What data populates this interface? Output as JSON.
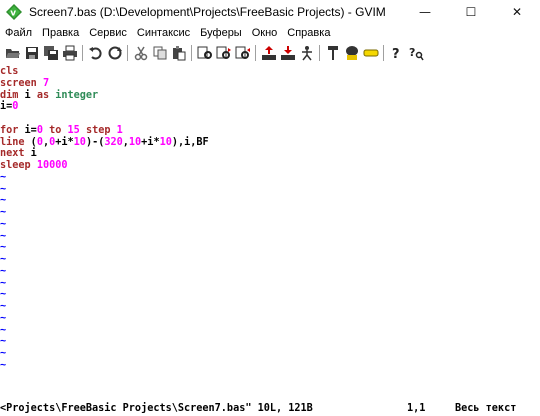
{
  "window": {
    "title": "Screen7.bas (D:\\Development\\Projects\\FreeBasic Projects) - GVIM",
    "minimize": "—",
    "maximize": "☐",
    "close": "✕"
  },
  "menu": [
    "Файл",
    "Правка",
    "Сервис",
    "Синтаксис",
    "Буферы",
    "Окно",
    "Справка"
  ],
  "toolbar_icons": [
    "open-icon",
    "save-icon",
    "save-all-icon",
    "print-icon",
    "undo-icon",
    "redo-icon",
    "cut-icon",
    "copy-icon",
    "paste-icon",
    "find-replace-icon",
    "find-next-icon",
    "find-prev-icon",
    "load-session-icon",
    "save-session-icon",
    "run-script-icon",
    "make-icon",
    "shell-icon",
    "tag-jump-icon",
    "help-icon",
    "find-help-icon"
  ],
  "editor": {
    "lines": [
      [
        {
          "t": "cls",
          "c": "kw"
        }
      ],
      [
        {
          "t": "screen ",
          "c": "kw"
        },
        {
          "t": "7",
          "c": "num"
        }
      ],
      [
        {
          "t": "dim",
          "c": "kw"
        },
        {
          "t": " i ",
          "c": ""
        },
        {
          "t": "as",
          "c": "kw"
        },
        {
          "t": " ",
          "c": ""
        },
        {
          "t": "integer",
          "c": "type"
        }
      ],
      [
        {
          "t": "i=",
          "c": ""
        },
        {
          "t": "0",
          "c": "num"
        }
      ],
      [],
      [
        {
          "t": "for",
          "c": "kw"
        },
        {
          "t": " i=",
          "c": ""
        },
        {
          "t": "0",
          "c": "num"
        },
        {
          "t": " ",
          "c": ""
        },
        {
          "t": "to",
          "c": "kw"
        },
        {
          "t": " ",
          "c": ""
        },
        {
          "t": "15",
          "c": "num"
        },
        {
          "t": " ",
          "c": ""
        },
        {
          "t": "step",
          "c": "kw"
        },
        {
          "t": " ",
          "c": ""
        },
        {
          "t": "1",
          "c": "num"
        }
      ],
      [
        {
          "t": "line",
          "c": "kw"
        },
        {
          "t": " (",
          "c": ""
        },
        {
          "t": "0",
          "c": "num"
        },
        {
          "t": ",",
          "c": ""
        },
        {
          "t": "0",
          "c": "num"
        },
        {
          "t": "+i*",
          "c": ""
        },
        {
          "t": "10",
          "c": "num"
        },
        {
          "t": ")-(",
          "c": ""
        },
        {
          "t": "320",
          "c": "num"
        },
        {
          "t": ",",
          "c": ""
        },
        {
          "t": "10",
          "c": "num"
        },
        {
          "t": "+i*",
          "c": ""
        },
        {
          "t": "10",
          "c": "num"
        },
        {
          "t": "),i,BF",
          "c": ""
        }
      ],
      [
        {
          "t": "next",
          "c": "kw"
        },
        {
          "t": " i",
          "c": ""
        }
      ],
      [
        {
          "t": "sleep",
          "c": "kw"
        },
        {
          "t": " ",
          "c": ""
        },
        {
          "t": "10000",
          "c": "num"
        }
      ]
    ],
    "empty_marker": "~",
    "empty_marker_count": 17
  },
  "status": {
    "message": "<Projects\\FreeBasic Projects\\Screen7.bas\" 10L, 121B",
    "position": "1,1",
    "percent": "Весь текст"
  },
  "colors": {
    "keyword": "#a52a2a",
    "number": "#ff00ff",
    "type": "#2e8b57",
    "tilde": "#0000ff"
  }
}
